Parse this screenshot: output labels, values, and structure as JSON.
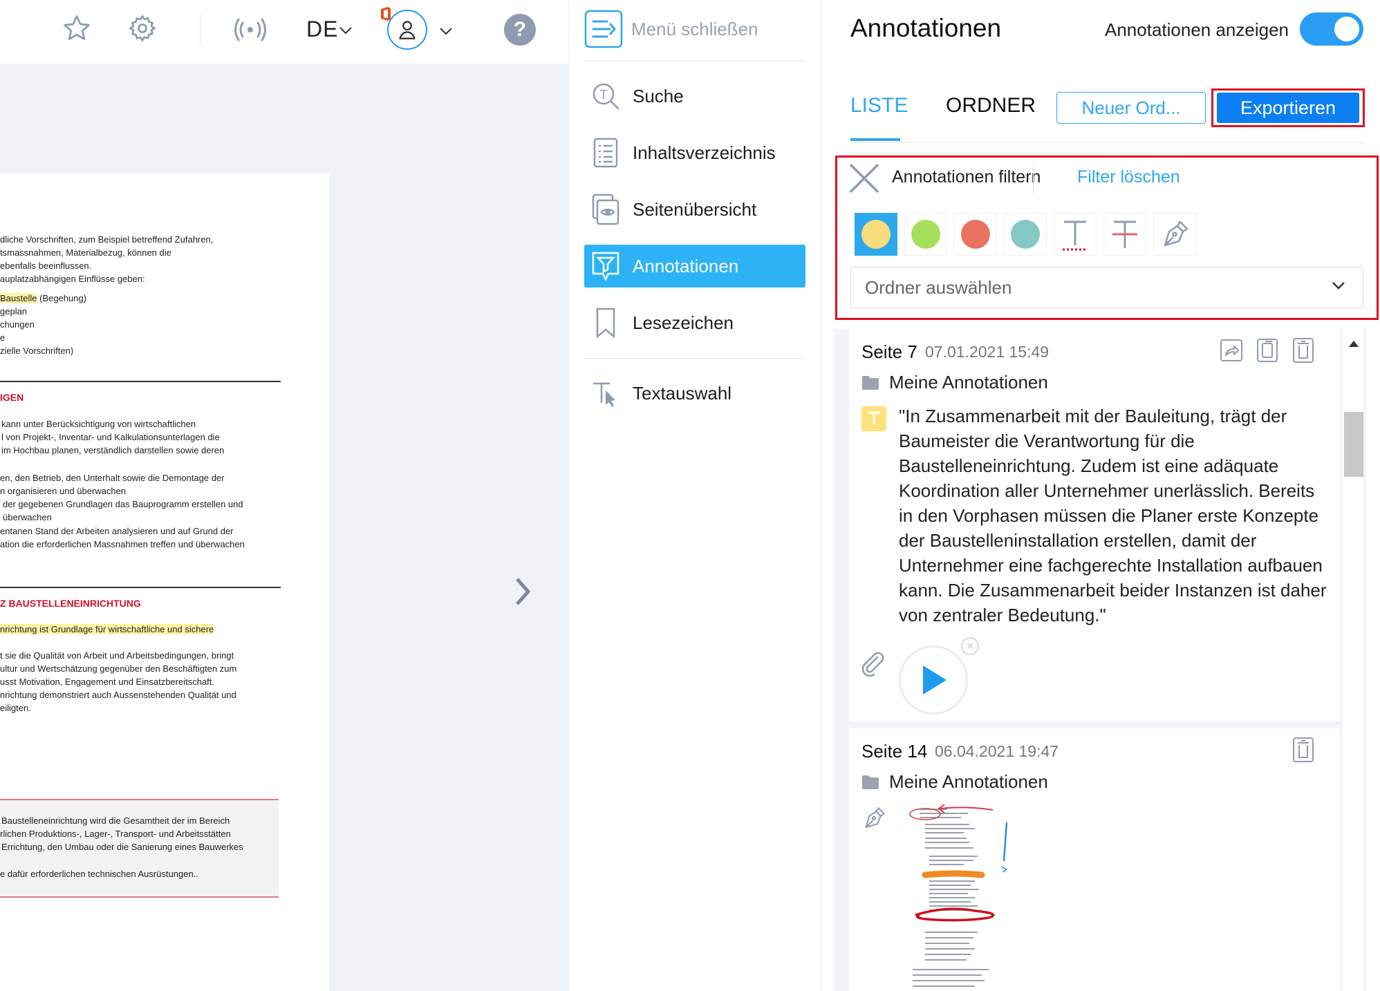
{
  "toolbar": {
    "language": "DE",
    "help_glyph": "?",
    "icons": [
      "star-icon",
      "gear-icon",
      "broadcast-icon",
      "chevron-down-icon",
      "office-icon",
      "user-icon",
      "help-icon"
    ]
  },
  "document": {
    "lines_a": [
      "dliche Vorschriften, zum Beispiel betreffend Zufahren,",
      "tsmassnahmen, Materialbezug, können die",
      "ebenfalls beeinflussen.",
      "auplatzabhängigen Einflüsse geben:"
    ],
    "lines_b_hl": "Baustelle",
    "lines_b_rest": " (Begehung)",
    "lines_b": [
      "geplan",
      "chungen",
      "e",
      "zielle Vorschriften)"
    ],
    "heading1": "IGEN",
    "lines_c": [
      "kann unter Berücksichtigung von wirtschaftlichen",
      "l von Projekt-, Inventar- und Kalkulationsunterlagen die",
      "im Hochbau planen, verständlich darstellen sowie deren",
      "",
      "en, den Betrieb, den Unterhalt sowie die Demontage der",
      "n organisieren und überwachen",
      "der gegebenen Grundlagen das Bauprogramm erstellen und",
      "überwachen",
      "entanen Stand der Arbeiten analysieren und auf Grund der",
      "ation die erforderlichen Massnahmen treffen und überwachen"
    ],
    "heading2": "Z BAUSTELLENEINRICHTUNG",
    "highlight_line": "nrichtung ist Grundlage für wirtschaftliche und sichere",
    "lines_d": [
      "t sie die Qualität von Arbeit und Arbeitsbedingungen, bringt",
      "ultur und Wertschätzung gegenüber den Beschäftigten zum",
      "usst Motivation, Engagement und Einsatzbereitschaft.",
      "nrichtung demonstriert auch Aussenstehenden Qualität und",
      "eiligten."
    ],
    "note_lines": [
      "Baustelleneinrichtung wird die Gesamtheit der im Bereich",
      "rlichen Produktions-, Lager-, Transport- und Arbeitsstätten",
      "Errichtung, den Umbau oder die Sanierung eines Bauwerkes",
      "",
      "e dafür erforderlichen technischen Ausrüstungen.."
    ],
    "next_arrow": "chevron-right-icon"
  },
  "menu": {
    "close_label": "Menü schließen",
    "items": [
      {
        "label": "Suche",
        "icon": "search-icon"
      },
      {
        "label": "Inhaltsverzeichnis",
        "icon": "toc-icon"
      },
      {
        "label": "Seitenübersicht",
        "icon": "page-overview-icon"
      },
      {
        "label": "Annotationen",
        "icon": "annotation-filter-icon",
        "active": true
      },
      {
        "label": "Lesezeichen",
        "icon": "bookmark-icon"
      },
      {
        "label": "Textauswahl",
        "icon": "text-select-icon"
      }
    ]
  },
  "panel": {
    "title": "Annotationen",
    "toggle_label": "Annotationen anzeigen",
    "toggle_on": true,
    "tabs": {
      "list": "LISTE",
      "folder": "ORDNER"
    },
    "new_folder_button": "Neuer Ord...",
    "export_button": "Exportieren",
    "filter": {
      "label": "Annotationen filtern",
      "clear": "Filter löschen",
      "colors": {
        "yellow": "#f7dc7c",
        "green": "#a5e05a",
        "red": "#e8735f",
        "teal": "#86c8c6"
      },
      "select_placeholder": "Ordner auswählen"
    },
    "cards": [
      {
        "page": "Seite 7",
        "date": "07.01.2021 15:49",
        "folder": "Meine Annotationen",
        "text": "\"In Zusammenarbeit mit der Bauleitung, trägt der Baumeister die Verantwortung für die Baustelleneinrichtung. Zudem ist eine adäquate Koordination aller Unternehmer unerlässlich. Bereits in den Vorphasen müssen die Planer erste Konzepte der Baustelleninstallation erstellen, damit der Unternehmer eine fachgerechte Installation aufbauen kann. Die Zusammenarbeit beider Instanzen ist daher von zentraler Bedeutung.\"",
        "remove_glyph": "×"
      },
      {
        "page": "Seite 14",
        "date": "06.04.2021 19:47",
        "folder": "Meine Annotationen"
      }
    ]
  }
}
